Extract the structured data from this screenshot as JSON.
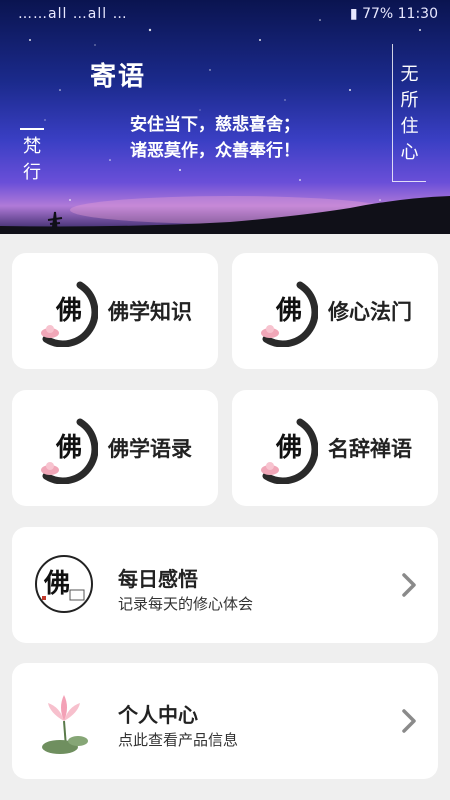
{
  "status_bar": {
    "left": "……all …all …",
    "battery": "77%",
    "time": "11:30"
  },
  "hero": {
    "title": "寄语",
    "quote_line1": "安住当下，慈悲喜舍；",
    "quote_line2": "诸恶莫作，众善奉行！",
    "vertical_left": "梵行",
    "vertical_right": "无所住心"
  },
  "cards": [
    {
      "label": "佛学知识",
      "icon": "buddha-ink-emblem-icon"
    },
    {
      "label": "修心法门",
      "icon": "buddha-ink-emblem-icon"
    },
    {
      "label": "佛学语录",
      "icon": "buddha-ink-emblem-icon"
    },
    {
      "label": "名辞禅语",
      "icon": "buddha-ink-emblem-icon"
    }
  ],
  "daily": {
    "title": "每日感悟",
    "subtitle": "记录每天的修心体会",
    "icon": "buddha-seal-emblem-icon"
  },
  "personal": {
    "title": "个人中心",
    "subtitle": "点此查看产品信息",
    "icon": "lotus-icon"
  },
  "colors": {
    "background": "#efefef",
    "card": "#ffffff",
    "text": "#222222",
    "chevron": "#8a8a8a"
  }
}
